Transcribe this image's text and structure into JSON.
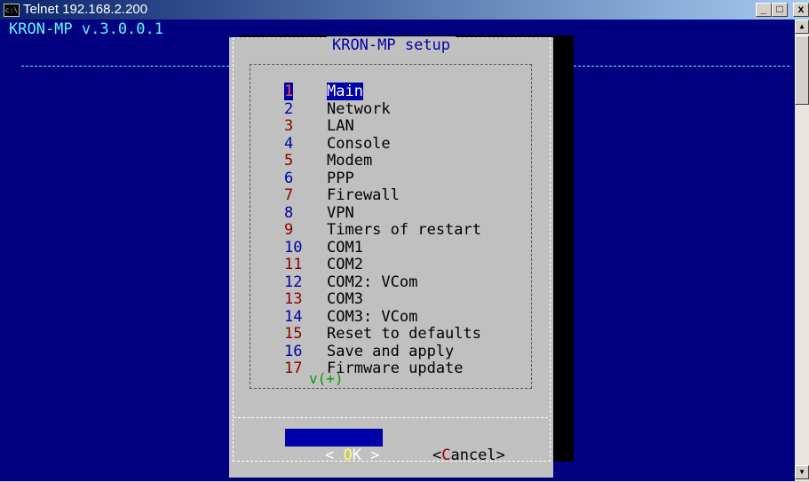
{
  "window": {
    "icon_text": "c:\\",
    "title": "Telnet 192.168.2.200",
    "minimize": "_",
    "maximize": "□",
    "close": "x"
  },
  "console": {
    "header": "KRON-MP v.3.0.0.1"
  },
  "dialog": {
    "title": "KRON-MP setup",
    "items": [
      {
        "num": "1",
        "label": "Main"
      },
      {
        "num": "2",
        "label": "Network"
      },
      {
        "num": "3",
        "label": "LAN"
      },
      {
        "num": "4",
        "label": "Console"
      },
      {
        "num": "5",
        "label": "Modem"
      },
      {
        "num": "6",
        "label": "PPP"
      },
      {
        "num": "7",
        "label": "Firewall"
      },
      {
        "num": "8",
        "label": "VPN"
      },
      {
        "num": "9",
        "label": "Timers of restart"
      },
      {
        "num": "10",
        "label": "COM1"
      },
      {
        "num": "11",
        "label": "COM2"
      },
      {
        "num": "12",
        "label": "COM2: VCom"
      },
      {
        "num": "13",
        "label": "COM3"
      },
      {
        "num": "14",
        "label": "COM3: VCom"
      },
      {
        "num": "15",
        "label": "Reset to defaults"
      },
      {
        "num": "16",
        "label": "Save and apply"
      },
      {
        "num": "17",
        "label": "Firmware update"
      }
    ],
    "selected_index": 0,
    "more_indicator": "v(+)",
    "ok": {
      "left": "< ",
      "hot": "O",
      "rest": "K",
      "right": " >"
    },
    "cancel": {
      "left": "<",
      "hot": "C",
      "rest": "ancel",
      "right": ">"
    }
  }
}
